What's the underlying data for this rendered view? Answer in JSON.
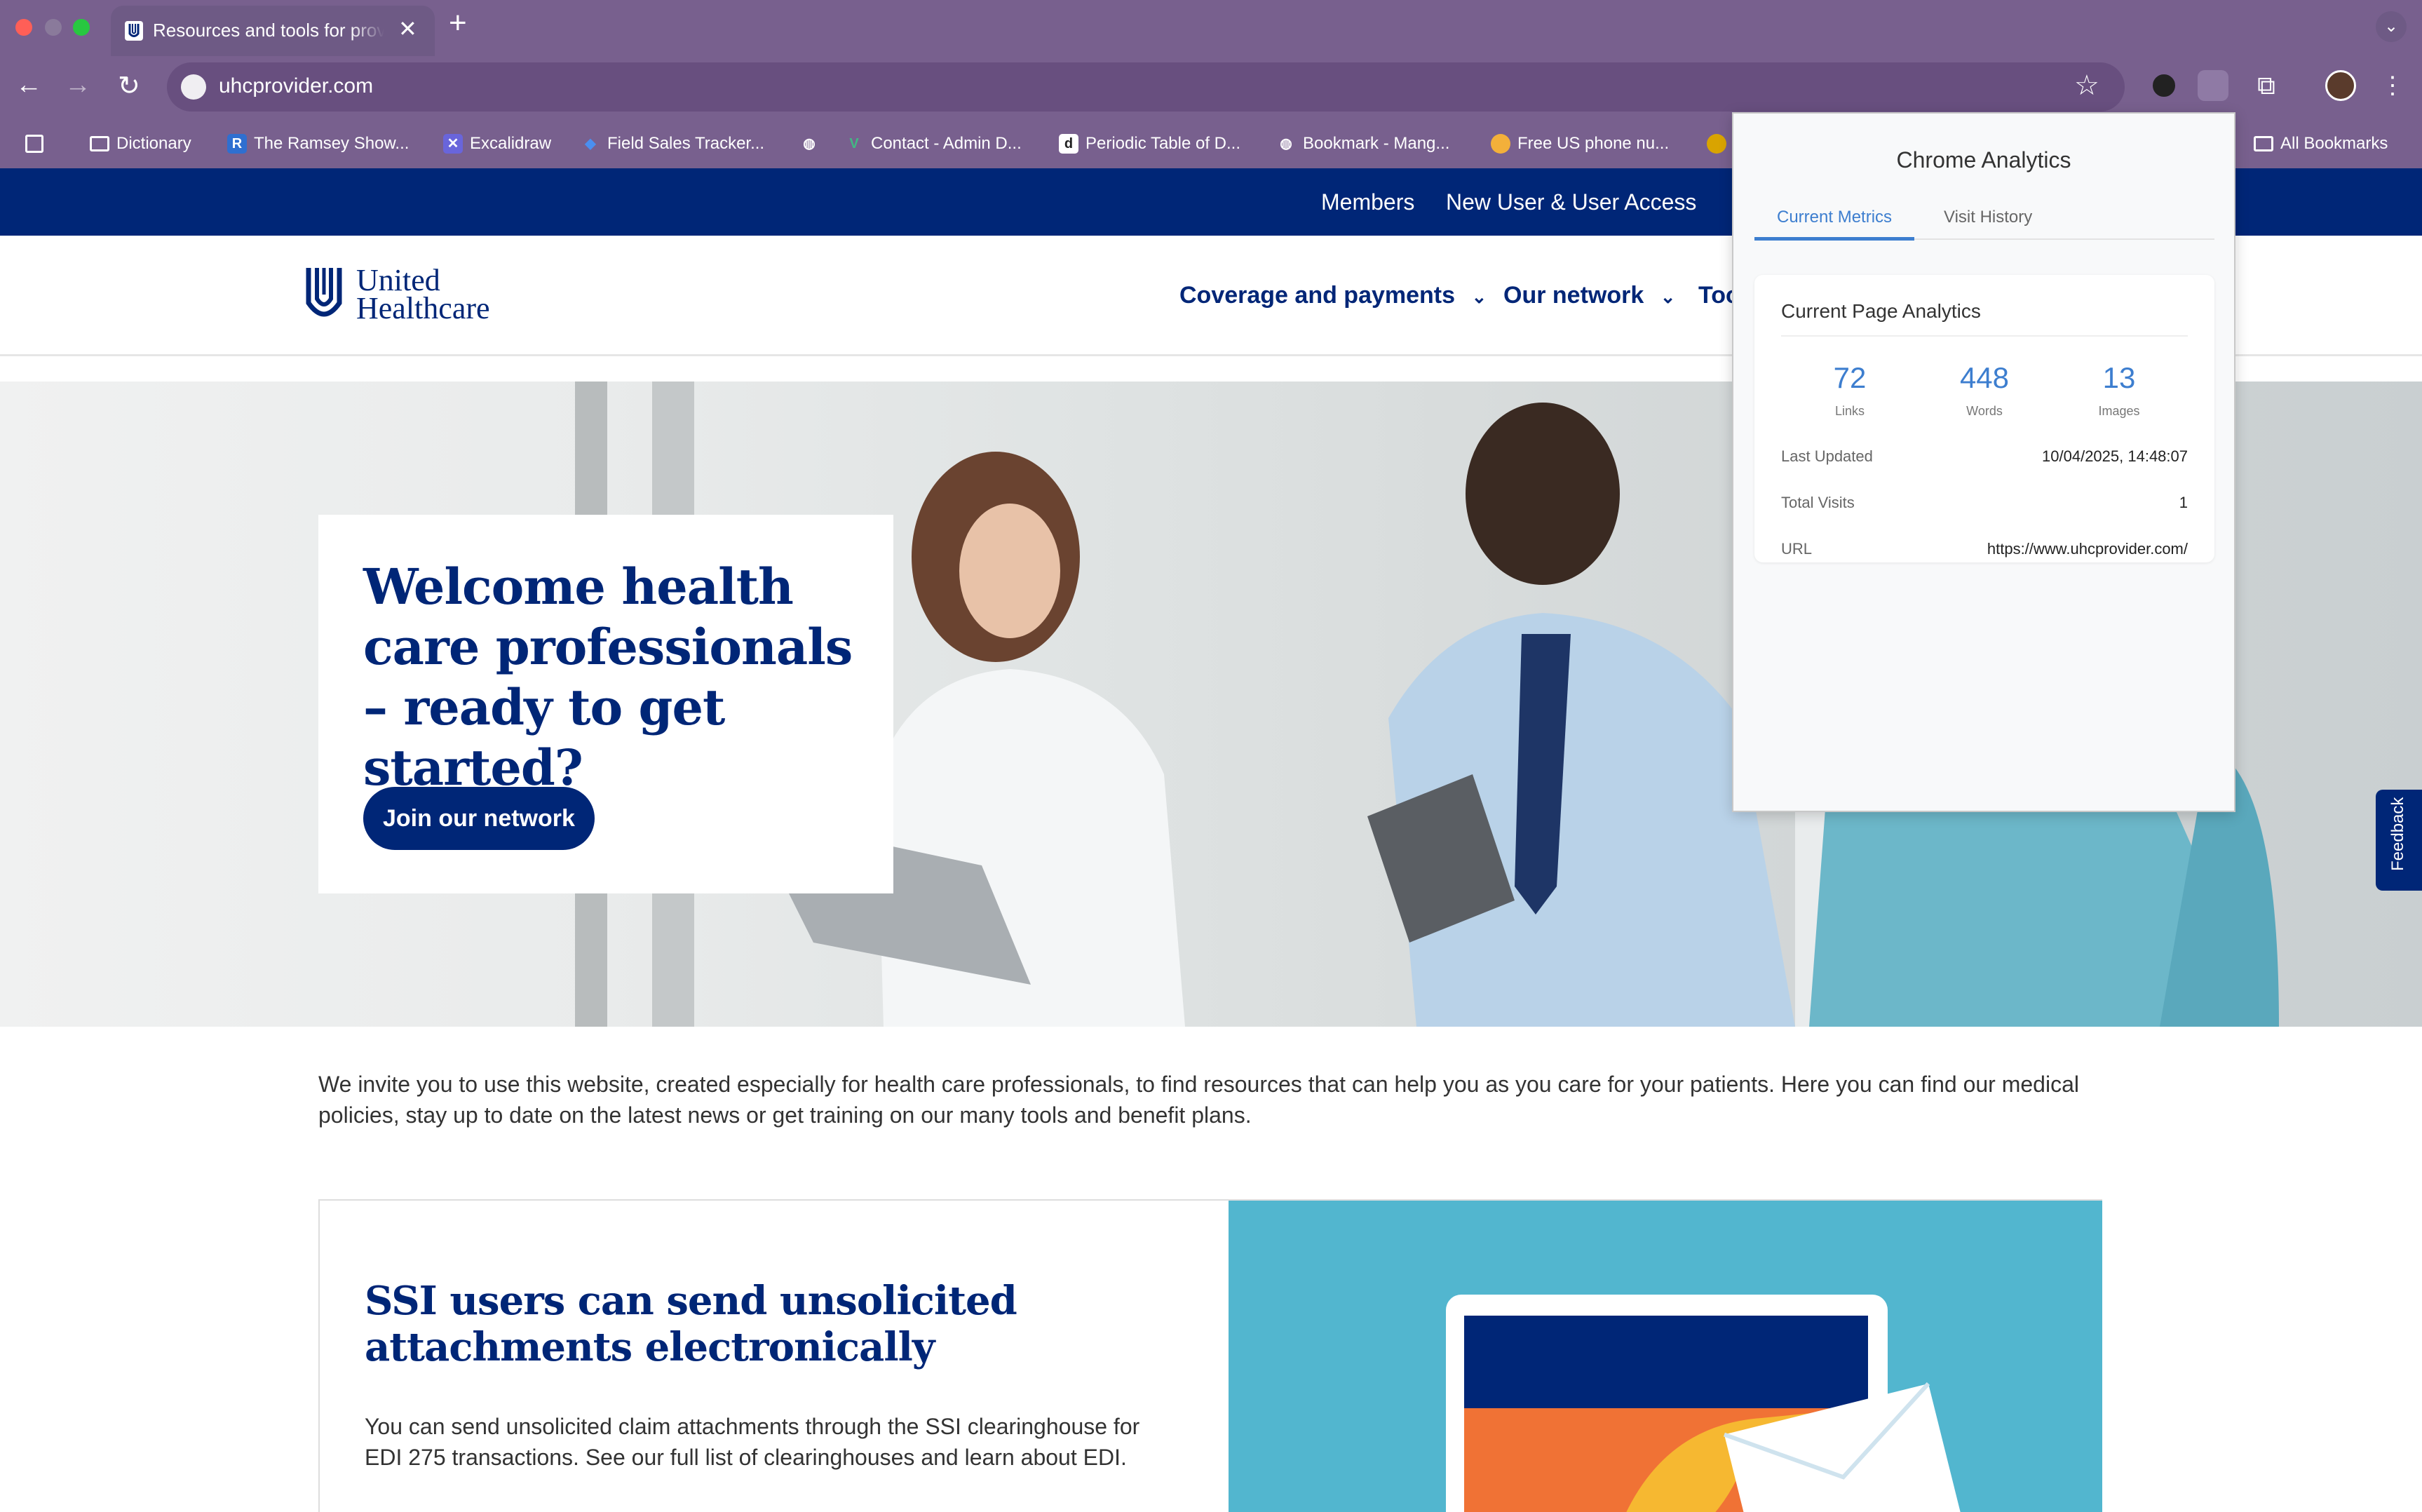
{
  "browser": {
    "tab_title": "Resources and tools for providers",
    "url": "uhcprovider.com",
    "bookmarks": [
      {
        "label": "Dictionary"
      },
      {
        "label": "The Ramsey Show..."
      },
      {
        "label": "Excalidraw"
      },
      {
        "label": "Field Sales Tracker..."
      },
      {
        "label": ""
      },
      {
        "label": "Contact - Admin D..."
      },
      {
        "label": "Periodic Table of D..."
      },
      {
        "label": "Bookmark - Mang..."
      },
      {
        "label": "Free US phone nu..."
      }
    ],
    "all_bookmarks": "All Bookmarks"
  },
  "site": {
    "topnav": {
      "members": "Members",
      "new_user": "New User & User Access"
    },
    "logo": {
      "line1": "United",
      "line2": "Healthcare"
    },
    "nav": {
      "coverage": "Coverage and payments",
      "network": "Our network",
      "tools": "Tools"
    },
    "hero": {
      "title": "Welcome health care professionals – ready to get started?",
      "cta": "Join our network"
    },
    "feedback": "Feedback",
    "intro": "We invite you to use this website, created especially for health care professionals, to find resources that can help you as you care for your patients. Here you can find our medical policies, stay up to date on the latest news or get training on our many tools and benefit plans.",
    "ssi": {
      "title": "SSI users can send unsolicited attachments electronically",
      "body": "You can send unsolicited claim attachments through the SSI clearinghouse for EDI 275 transactions. See our full list of clearinghouses and learn about EDI."
    }
  },
  "extension": {
    "title": "Chrome Analytics",
    "tabs": [
      "Current Metrics",
      "Visit History"
    ],
    "card_title": "Current Page Analytics",
    "metrics": [
      {
        "value": "72",
        "label": "Links"
      },
      {
        "value": "448",
        "label": "Words"
      },
      {
        "value": "13",
        "label": "Images"
      }
    ],
    "rows": [
      {
        "label": "Last Updated",
        "value": "10/04/2025, 14:48:07"
      },
      {
        "label": "Total Visits",
        "value": "1"
      },
      {
        "label": "URL",
        "value": "https://www.uhcprovider.com/"
      }
    ]
  },
  "colors": {
    "brand_navy": "#002677",
    "browser_purple": "#78608e",
    "accent_blue": "#3d7ecf",
    "ssi_teal": "#52b6cf"
  }
}
